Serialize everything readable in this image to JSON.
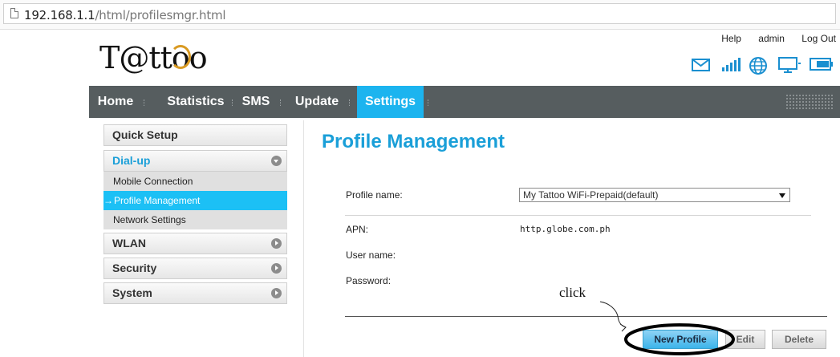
{
  "browser": {
    "url_host": "192.168.1.1",
    "url_path": "/html/profilesmgr.html"
  },
  "header": {
    "logo_text": "T@ttoo",
    "links": [
      "Help",
      "admin",
      "Log Out"
    ],
    "status_icons": [
      "mail-icon",
      "signal-strength-icon",
      "globe-icon",
      "computer-icon",
      "battery-icon"
    ]
  },
  "nav": {
    "items": [
      "Home",
      "Statistics",
      "SMS",
      "Update",
      "Settings"
    ],
    "active": "Settings"
  },
  "sidebar": {
    "quick_setup": "Quick Setup",
    "dialup": "Dial-up",
    "dialup_items": [
      "Mobile Connection",
      "Profile Management",
      "Network Settings"
    ],
    "active_item": "Profile Management",
    "active_arrow": "→",
    "wlan": "WLAN",
    "security": "Security",
    "system": "System"
  },
  "main": {
    "title": "Profile Management",
    "profile_name_label": "Profile name:",
    "profile_selected": "My Tattoo WiFi-Prepaid(default)",
    "apn_label": "APN:",
    "apn_value": "http.globe.com.ph",
    "username_label": "User name:",
    "password_label": "Password:",
    "buttons": {
      "new_profile": "New Profile",
      "edit": "Edit",
      "delete": "Delete"
    }
  },
  "annotation": {
    "text": "click"
  },
  "colors": {
    "accent": "#1a9fd8",
    "nav_bg": "#565d5f",
    "nav_active": "#1cb4ef"
  }
}
